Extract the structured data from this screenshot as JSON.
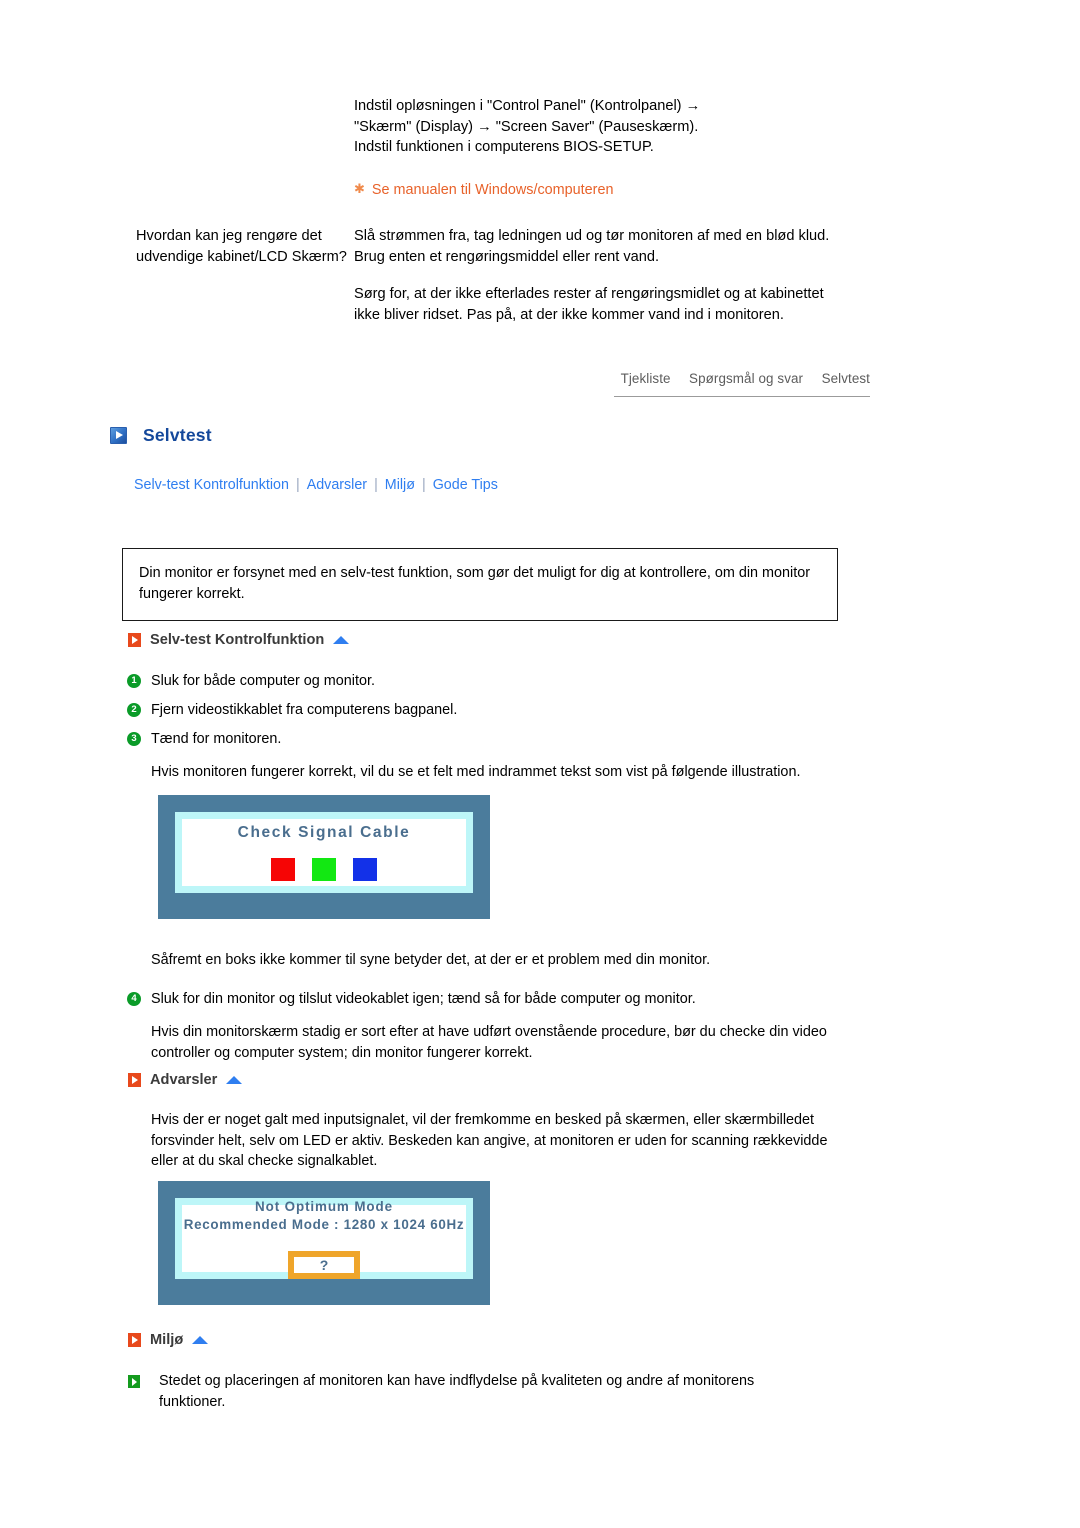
{
  "faq_top": {
    "answer_continued": [
      "Indstil opløsningen i \"Control Panel\" (Kontrolpanel) →",
      "\"Skærm\" (Display) → \"Screen Saver\" (Pauseskærm).",
      "Indstil funktionen i computerens BIOS-SETUP."
    ],
    "note_icon": "asterisk-icon",
    "note_text": "Se manualen til Windows/computeren",
    "question": "Hvordan kan jeg rengøre det udvendige kabinet/LCD Skærm?",
    "answer_p1": "Slå strømmen fra, tag ledningen ud og tør monitoren af med en blød klud. Brug enten et rengøringsmiddel eller rent vand.",
    "answer_p2": "Sørg for, at der ikke efterlades rester af rengøringsmidlet og at kabinettet ikke bliver ridset. Pas på, at der ikke kommer vand ind i monitoren."
  },
  "tabs": [
    {
      "label": "Tjekliste"
    },
    {
      "label": "Spørgsmål og svar"
    },
    {
      "label": "Selvtest"
    }
  ],
  "heading": {
    "icon": "blue-play-square-icon",
    "title": "Selvtest"
  },
  "subnav": {
    "separator": "|",
    "items": [
      {
        "label": "Selv-test Kontrolfunktion"
      },
      {
        "label": "Advarsler"
      },
      {
        "label": "Miljø"
      },
      {
        "label": "Gode Tips"
      }
    ]
  },
  "description_box": {
    "text": "Din monitor er forsynet med en selv-test funktion, som gør det muligt for dig at kontrollere, om din monitor fungerer korrekt."
  },
  "section_selftest": {
    "icon": "orange-play-square-icon",
    "top_icon": "scroll-to-top-triangle-icon",
    "title": "Selv-test Kontrolfunktion",
    "steps": [
      {
        "number": "1",
        "text": "Sluk for både computer og monitor."
      },
      {
        "number": "2",
        "text": "Fjern videostikkablet fra computerens bagpanel."
      },
      {
        "number": "3",
        "text": "Tænd for monitoren."
      }
    ],
    "after_steps": "Hvis monitoren fungerer korrekt, vil du se et felt med indrammet tekst som vist på følgende illustration.",
    "monitor_graphic": {
      "title": "Check Signal Cable",
      "swatches": [
        {
          "name": "red-swatch",
          "color": "#f60505"
        },
        {
          "name": "green-swatch",
          "color": "#12e812"
        },
        {
          "name": "blue-swatch",
          "color": "#1331e8"
        }
      ],
      "bezel_color": "#4b7c9c",
      "inner_border_color": "#bdf6f8"
    },
    "after_graphic": "Såfremt en boks ikke kommer til syne betyder det, at der er et problem med din monitor.",
    "step4": {
      "number": "4",
      "text": "Sluk for din monitor og tilslut videokablet igen; tænd så for både computer og monitor."
    },
    "after_step4": "Hvis din monitorskærm stadig er sort efter at have udført ovenstående procedure, bør du checke din video controller og computer system; din monitor fungerer korrekt."
  },
  "section_advarsler": {
    "icon": "orange-play-square-icon",
    "top_icon": "scroll-to-top-triangle-icon",
    "title": "Advarsler",
    "text": "Hvis der er noget galt med inputsignalet, vil der fremkomme en besked på skærmen, eller skærmbilledet forsvinder helt, selv om LED er aktiv. Beskeden kan angive, at monitoren er uden for scanning rækkevidde eller at du skal checke signalkablet.",
    "monitor_graphic": {
      "line1": "Not Optimum Mode",
      "line2": "Recommended Mode : 1280 x 1024  60Hz",
      "question_mark": "?",
      "question_box_border_color": "#efa52a",
      "bezel_color": "#4b7c9c",
      "inner_border_color": "#bdf6f8"
    }
  },
  "section_miljo": {
    "icon": "orange-play-square-icon",
    "top_icon": "scroll-to-top-triangle-icon",
    "title": "Miljø",
    "bullet_icon": "green-play-square-icon",
    "bullet_text": "Stedet og placeringen af monitoren kan have indflydelse på kvaliteten og andre af monitorens funktioner."
  }
}
